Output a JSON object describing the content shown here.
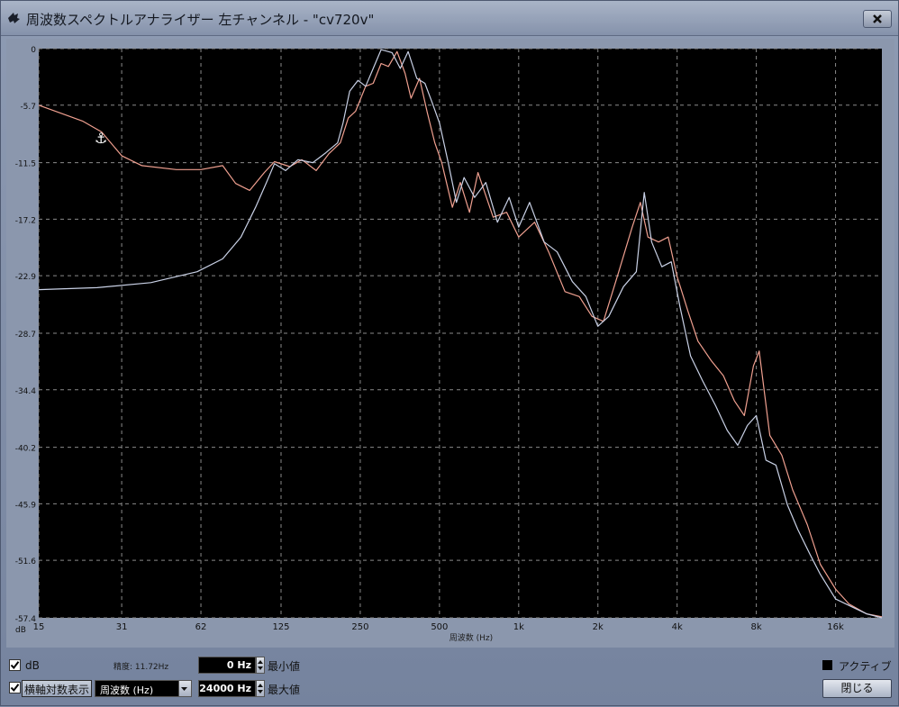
{
  "window": {
    "title": "周波数スペクトルアナライザー 左チャンネル - \"cv720v\""
  },
  "colors": {
    "plot_background": "#000000",
    "grid": "#8a8a8a",
    "series_white": "#c9d1e6",
    "series_red": "#f0a090"
  },
  "chart_data": {
    "type": "line",
    "title": "",
    "xlabel": "周波数 (Hz)",
    "ylabel": "dB",
    "x_scale": "log",
    "x_ticks": [
      15,
      31,
      62,
      125,
      250,
      500,
      1000,
      2000,
      4000,
      8000,
      16000
    ],
    "x_tick_labels": [
      "15",
      "31",
      "62",
      "125",
      "250",
      "500",
      "1k",
      "2k",
      "4k",
      "8k",
      "16k"
    ],
    "y_ticks": [
      0,
      -5.7,
      -11.5,
      -17.2,
      -22.9,
      -28.7,
      -34.4,
      -40.2,
      -45.9,
      -51.6,
      -57.4
    ],
    "y_tick_labels": [
      "0",
      "-5.7",
      "-11.5",
      "-17.2",
      "-22.9",
      "-28.7",
      "-34.4",
      "-40.2",
      "-45.9",
      "-51.6",
      "-57.4"
    ],
    "xlim": [
      15,
      24000
    ],
    "ylim": [
      -57.4,
      0
    ],
    "grid": true,
    "series": [
      {
        "color": "#f0a090",
        "points": [
          [
            15,
            -5.7
          ],
          [
            22,
            -7.3
          ],
          [
            26,
            -8.4
          ],
          [
            31,
            -10.8
          ],
          [
            37,
            -11.8
          ],
          [
            50,
            -12.2
          ],
          [
            62,
            -12.2
          ],
          [
            75,
            -11.8
          ],
          [
            84,
            -13.6
          ],
          [
            95,
            -14.3
          ],
          [
            108,
            -12.5
          ],
          [
            118,
            -11.4
          ],
          [
            135,
            -11.9
          ],
          [
            150,
            -11.2
          ],
          [
            170,
            -12.3
          ],
          [
            190,
            -10.6
          ],
          [
            210,
            -9.5
          ],
          [
            225,
            -7.0
          ],
          [
            240,
            -6.3
          ],
          [
            262,
            -3.8
          ],
          [
            280,
            -3.5
          ],
          [
            300,
            -1.5
          ],
          [
            320,
            -1.8
          ],
          [
            345,
            -0.3
          ],
          [
            370,
            -2.5
          ],
          [
            390,
            -5.0
          ],
          [
            420,
            -3.0
          ],
          [
            450,
            -6.5
          ],
          [
            480,
            -9.5
          ],
          [
            510,
            -11.5
          ],
          [
            560,
            -16.0
          ],
          [
            600,
            -13.5
          ],
          [
            650,
            -16.5
          ],
          [
            700,
            -12.5
          ],
          [
            800,
            -17.0
          ],
          [
            900,
            -16.5
          ],
          [
            1000,
            -19.0
          ],
          [
            1150,
            -17.5
          ],
          [
            1300,
            -20.5
          ],
          [
            1500,
            -24.5
          ],
          [
            1700,
            -25.0
          ],
          [
            1900,
            -27.0
          ],
          [
            2100,
            -27.5
          ],
          [
            2400,
            -22.5
          ],
          [
            2700,
            -18.0
          ],
          [
            2900,
            -15.5
          ],
          [
            3100,
            -19.0
          ],
          [
            3400,
            -19.5
          ],
          [
            3700,
            -19.0
          ],
          [
            4000,
            -23.0
          ],
          [
            4400,
            -26.5
          ],
          [
            4800,
            -29.5
          ],
          [
            5400,
            -31.5
          ],
          [
            6000,
            -33.0
          ],
          [
            6600,
            -35.5
          ],
          [
            7200,
            -37.0
          ],
          [
            7800,
            -32.0
          ],
          [
            8200,
            -30.5
          ],
          [
            9000,
            -39.0
          ],
          [
            10000,
            -41.0
          ],
          [
            11000,
            -44.5
          ],
          [
            12500,
            -48.0
          ],
          [
            14000,
            -52.0
          ],
          [
            16000,
            -54.5
          ],
          [
            18000,
            -56.0
          ],
          [
            21000,
            -57.0
          ],
          [
            24000,
            -57.3
          ]
        ]
      },
      {
        "color": "#c9d1e6",
        "points": [
          [
            15,
            -24.3
          ],
          [
            25,
            -24.1
          ],
          [
            40,
            -23.6
          ],
          [
            60,
            -22.5
          ],
          [
            75,
            -21.2
          ],
          [
            88,
            -19.0
          ],
          [
            100,
            -16.0
          ],
          [
            110,
            -13.5
          ],
          [
            118,
            -11.6
          ],
          [
            130,
            -12.3
          ],
          [
            145,
            -11.2
          ],
          [
            165,
            -11.5
          ],
          [
            185,
            -10.5
          ],
          [
            205,
            -9.5
          ],
          [
            215,
            -7.5
          ],
          [
            228,
            -4.3
          ],
          [
            245,
            -3.2
          ],
          [
            262,
            -3.8
          ],
          [
            280,
            -2.0
          ],
          [
            300,
            -0.1
          ],
          [
            330,
            -0.4
          ],
          [
            355,
            -2.0
          ],
          [
            380,
            -0.3
          ],
          [
            410,
            -3.0
          ],
          [
            440,
            -3.5
          ],
          [
            470,
            -5.5
          ],
          [
            500,
            -7.5
          ],
          [
            540,
            -11.5
          ],
          [
            580,
            -15.5
          ],
          [
            620,
            -13.0
          ],
          [
            680,
            -15.0
          ],
          [
            750,
            -13.5
          ],
          [
            830,
            -17.5
          ],
          [
            920,
            -15.0
          ],
          [
            1000,
            -18.0
          ],
          [
            1100,
            -15.5
          ],
          [
            1250,
            -19.5
          ],
          [
            1400,
            -20.5
          ],
          [
            1600,
            -23.5
          ],
          [
            1800,
            -25.0
          ],
          [
            2000,
            -28.0
          ],
          [
            2200,
            -27.0
          ],
          [
            2500,
            -24.0
          ],
          [
            2800,
            -22.5
          ],
          [
            3000,
            -14.5
          ],
          [
            3200,
            -19.5
          ],
          [
            3500,
            -22.0
          ],
          [
            3800,
            -21.5
          ],
          [
            4100,
            -26.0
          ],
          [
            4500,
            -31.0
          ],
          [
            5000,
            -33.5
          ],
          [
            5600,
            -36.0
          ],
          [
            6200,
            -38.5
          ],
          [
            6800,
            -40.0
          ],
          [
            7400,
            -38.0
          ],
          [
            8000,
            -37.0
          ],
          [
            8700,
            -41.5
          ],
          [
            9500,
            -42.0
          ],
          [
            10500,
            -46.0
          ],
          [
            11500,
            -48.5
          ],
          [
            12800,
            -51.0
          ],
          [
            14000,
            -53.0
          ],
          [
            16000,
            -55.5
          ],
          [
            18500,
            -56.3
          ],
          [
            21000,
            -57.0
          ],
          [
            24000,
            -57.4
          ]
        ]
      }
    ]
  },
  "controls": {
    "db_label": "dB",
    "db_checked": true,
    "resolution_label": "精度: 11.72Hz",
    "log_axis_label": "横軸対数表示",
    "log_axis_checked": true,
    "axis_unit_selected": "周波数 (Hz)",
    "min_value": "0 Hz",
    "min_label": "最小値",
    "max_value": "24000 Hz",
    "max_label": "最大値",
    "active_label": "アクティブ",
    "close_label": "閉じる"
  }
}
